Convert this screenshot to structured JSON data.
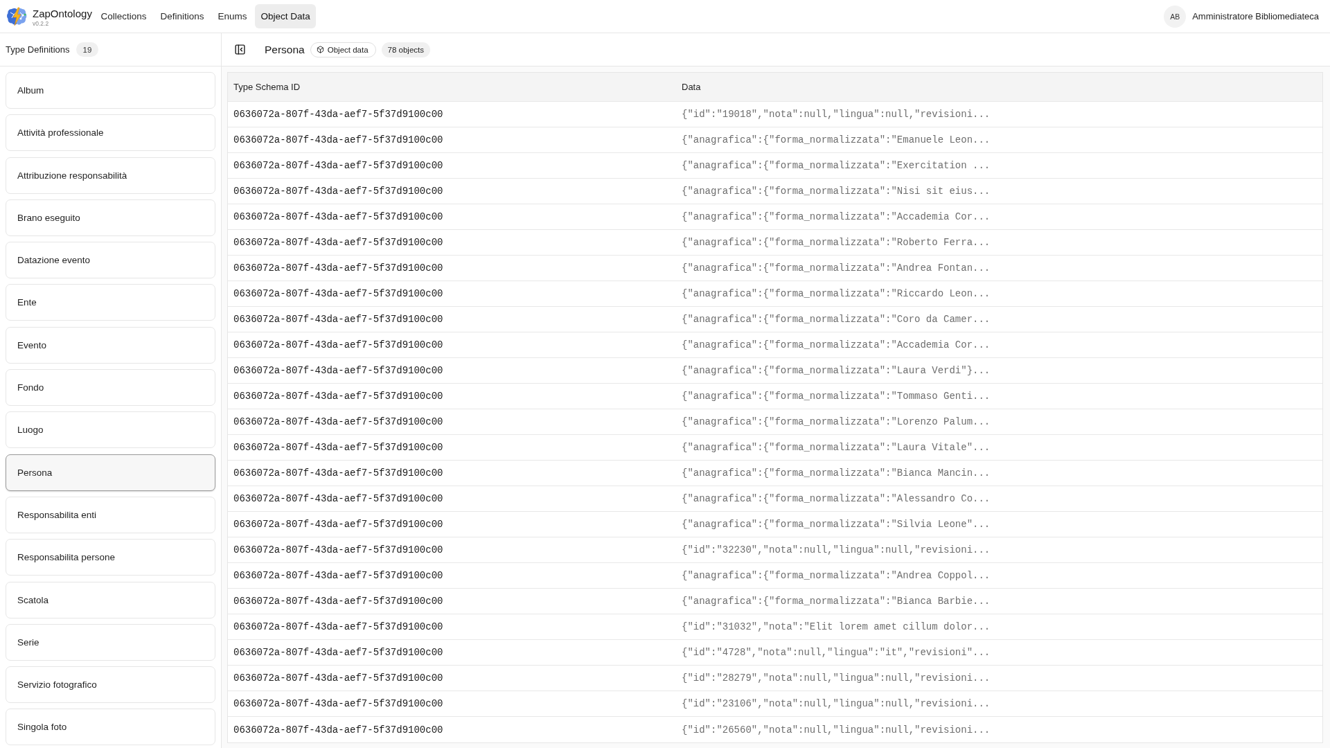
{
  "app": {
    "name": "ZapOntology",
    "version": "v0.2.2"
  },
  "nav": [
    {
      "label": "Collections",
      "selected": false
    },
    {
      "label": "Definitions",
      "selected": false
    },
    {
      "label": "Enums",
      "selected": false
    },
    {
      "label": "Object Data",
      "selected": true
    }
  ],
  "user": {
    "initials": "AB",
    "name": "Amministratore Bibliomediateca"
  },
  "sidebar": {
    "title": "Type Definitions",
    "count": "19",
    "items": [
      {
        "label": "Album",
        "selected": false
      },
      {
        "label": "Attività professionale",
        "selected": false
      },
      {
        "label": "Attribuzione responsabilità",
        "selected": false
      },
      {
        "label": "Brano eseguito",
        "selected": false
      },
      {
        "label": "Datazione evento",
        "selected": false
      },
      {
        "label": "Ente",
        "selected": false
      },
      {
        "label": "Evento",
        "selected": false
      },
      {
        "label": "Fondo",
        "selected": false
      },
      {
        "label": "Luogo",
        "selected": false
      },
      {
        "label": "Persona",
        "selected": true
      },
      {
        "label": "Responsabilita enti",
        "selected": false
      },
      {
        "label": "Responsabilita persone",
        "selected": false
      },
      {
        "label": "Scatola",
        "selected": false
      },
      {
        "label": "Serie",
        "selected": false
      },
      {
        "label": "Servizio fotografico",
        "selected": false
      },
      {
        "label": "Singola foto",
        "selected": false
      }
    ]
  },
  "header": {
    "title": "Persona",
    "type_badge": "Object data",
    "count_badge": "78 objects"
  },
  "table": {
    "columns": [
      "Type Schema ID",
      "Data"
    ],
    "rows": [
      {
        "type_schema_id": "0636072a-807f-43da-aef7-5f37d9100c00",
        "data": "{\"id\":\"19018\",\"nota\":null,\"lingua\":null,\"revisioni..."
      },
      {
        "type_schema_id": "0636072a-807f-43da-aef7-5f37d9100c00",
        "data": "{\"anagrafica\":{\"forma_normalizzata\":\"Emanuele Leon..."
      },
      {
        "type_schema_id": "0636072a-807f-43da-aef7-5f37d9100c00",
        "data": "{\"anagrafica\":{\"forma_normalizzata\":\"Exercitation ..."
      },
      {
        "type_schema_id": "0636072a-807f-43da-aef7-5f37d9100c00",
        "data": "{\"anagrafica\":{\"forma_normalizzata\":\"Nisi sit eius..."
      },
      {
        "type_schema_id": "0636072a-807f-43da-aef7-5f37d9100c00",
        "data": "{\"anagrafica\":{\"forma_normalizzata\":\"Accademia Cor..."
      },
      {
        "type_schema_id": "0636072a-807f-43da-aef7-5f37d9100c00",
        "data": "{\"anagrafica\":{\"forma_normalizzata\":\"Roberto Ferra..."
      },
      {
        "type_schema_id": "0636072a-807f-43da-aef7-5f37d9100c00",
        "data": "{\"anagrafica\":{\"forma_normalizzata\":\"Andrea Fontan..."
      },
      {
        "type_schema_id": "0636072a-807f-43da-aef7-5f37d9100c00",
        "data": "{\"anagrafica\":{\"forma_normalizzata\":\"Riccardo Leon..."
      },
      {
        "type_schema_id": "0636072a-807f-43da-aef7-5f37d9100c00",
        "data": "{\"anagrafica\":{\"forma_normalizzata\":\"Coro da Camer..."
      },
      {
        "type_schema_id": "0636072a-807f-43da-aef7-5f37d9100c00",
        "data": "{\"anagrafica\":{\"forma_normalizzata\":\"Accademia Cor..."
      },
      {
        "type_schema_id": "0636072a-807f-43da-aef7-5f37d9100c00",
        "data": "{\"anagrafica\":{\"forma_normalizzata\":\"Laura Verdi\"}..."
      },
      {
        "type_schema_id": "0636072a-807f-43da-aef7-5f37d9100c00",
        "data": "{\"anagrafica\":{\"forma_normalizzata\":\"Tommaso Genti..."
      },
      {
        "type_schema_id": "0636072a-807f-43da-aef7-5f37d9100c00",
        "data": "{\"anagrafica\":{\"forma_normalizzata\":\"Lorenzo Palum..."
      },
      {
        "type_schema_id": "0636072a-807f-43da-aef7-5f37d9100c00",
        "data": "{\"anagrafica\":{\"forma_normalizzata\":\"Laura Vitale\"..."
      },
      {
        "type_schema_id": "0636072a-807f-43da-aef7-5f37d9100c00",
        "data": "{\"anagrafica\":{\"forma_normalizzata\":\"Bianca Mancin..."
      },
      {
        "type_schema_id": "0636072a-807f-43da-aef7-5f37d9100c00",
        "data": "{\"anagrafica\":{\"forma_normalizzata\":\"Alessandro Co..."
      },
      {
        "type_schema_id": "0636072a-807f-43da-aef7-5f37d9100c00",
        "data": "{\"anagrafica\":{\"forma_normalizzata\":\"Silvia Leone\"..."
      },
      {
        "type_schema_id": "0636072a-807f-43da-aef7-5f37d9100c00",
        "data": "{\"id\":\"32230\",\"nota\":null,\"lingua\":null,\"revisioni..."
      },
      {
        "type_schema_id": "0636072a-807f-43da-aef7-5f37d9100c00",
        "data": "{\"anagrafica\":{\"forma_normalizzata\":\"Andrea Coppol..."
      },
      {
        "type_schema_id": "0636072a-807f-43da-aef7-5f37d9100c00",
        "data": "{\"anagrafica\":{\"forma_normalizzata\":\"Bianca Barbie..."
      },
      {
        "type_schema_id": "0636072a-807f-43da-aef7-5f37d9100c00",
        "data": "{\"id\":\"31032\",\"nota\":\"Elit lorem amet cillum dolor..."
      },
      {
        "type_schema_id": "0636072a-807f-43da-aef7-5f37d9100c00",
        "data": "{\"id\":\"4728\",\"nota\":null,\"lingua\":\"it\",\"revisioni\"..."
      },
      {
        "type_schema_id": "0636072a-807f-43da-aef7-5f37d9100c00",
        "data": "{\"id\":\"28279\",\"nota\":null,\"lingua\":null,\"revisioni..."
      },
      {
        "type_schema_id": "0636072a-807f-43da-aef7-5f37d9100c00",
        "data": "{\"id\":\"23106\",\"nota\":null,\"lingua\":null,\"revisioni..."
      },
      {
        "type_schema_id": "0636072a-807f-43da-aef7-5f37d9100c00",
        "data": "{\"id\":\"26560\",\"nota\":null,\"lingua\":null,\"revisioni..."
      }
    ]
  }
}
